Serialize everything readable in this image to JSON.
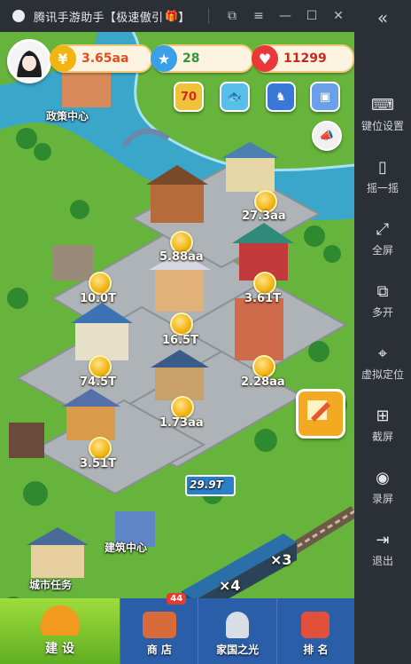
{
  "window": {
    "title": "腾讯手游助手【极速傲引",
    "gift_icon": "gift-icon",
    "controls": [
      "restore-icon",
      "menu-icon",
      "minimize-icon",
      "maximize-icon",
      "close-icon"
    ]
  },
  "resources": {
    "gold": "3.65aa",
    "stars": "28",
    "hearts": "11299"
  },
  "map_labels": {
    "policy_center": "政策中心",
    "building_center": "建筑中心",
    "city_tasks": "城市任务",
    "rail_sign": "29.9T"
  },
  "coin_values": [
    "27.3aa",
    "5.88aa",
    "10.0T",
    "3.61T",
    "16.5T",
    "74.5T",
    "2.28aa",
    "1.73aa",
    "3.51T"
  ],
  "train_counts": [
    "×3",
    "×4"
  ],
  "top_event_icon": "70",
  "bottom_tabs": [
    {
      "label": "建 设"
    },
    {
      "label": "商 店",
      "badge": "44"
    },
    {
      "label": "家国之光"
    },
    {
      "label": "排 名"
    }
  ],
  "sidebar": {
    "collapse_icon": "«",
    "items": [
      {
        "label": "键位设置",
        "icon": "keyboard-icon"
      },
      {
        "label": "摇一摇",
        "icon": "shake-icon"
      },
      {
        "label": "全屏",
        "icon": "fullscreen-icon"
      },
      {
        "label": "多开",
        "icon": "multi-instance-icon"
      },
      {
        "label": "虚拟定位",
        "icon": "location-icon"
      },
      {
        "label": "截屏",
        "icon": "screenshot-icon"
      },
      {
        "label": "录屏",
        "icon": "record-icon"
      },
      {
        "label": "退出",
        "icon": "exit-icon"
      }
    ]
  },
  "colors": {
    "gold_accent": "#f2b411",
    "star_accent": "#3aa0e8",
    "heart_accent": "#e8383a",
    "build_tab": "#7cc62e",
    "bottom_bar": "#2b5ea8"
  }
}
